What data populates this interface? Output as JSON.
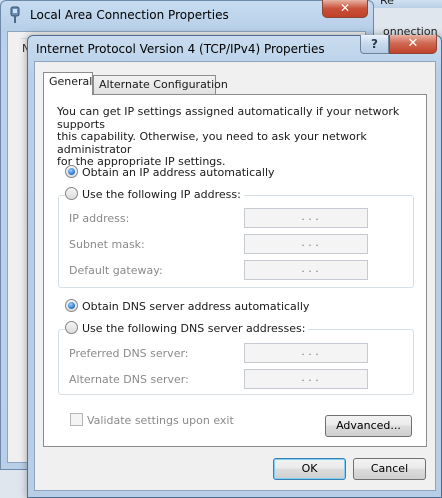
{
  "background": {
    "window_title": "Local Area Connection Properties",
    "partial_text_top": "Re",
    "partial_text_right": "onnection",
    "partial_letter": "N",
    "close_glyph": "✕"
  },
  "dialog": {
    "title": "Internet Protocol Version 4 (TCP/IPv4) Properties",
    "help_glyph": "?",
    "close_glyph": "✕",
    "tabs": [
      {
        "label": "General",
        "active": true
      },
      {
        "label": "Alternate Configuration",
        "active": false
      }
    ],
    "intro": "You can get IP settings assigned automatically if your network supports\nthis capability. Otherwise, you need to ask your network administrator\nfor the appropriate IP settings.",
    "ip_auto_label": "Obtain an IP address automatically",
    "ip_manual_label": "Use the following IP address:",
    "ip_fields": [
      {
        "label": "IP address:",
        "value": ".      .      ."
      },
      {
        "label": "Subnet mask:",
        "value": ".      .      ."
      },
      {
        "label": "Default gateway:",
        "value": ".      .      ."
      }
    ],
    "dns_auto_label": "Obtain DNS server address automatically",
    "dns_manual_label": "Use the following DNS server addresses:",
    "dns_fields": [
      {
        "label": "Preferred DNS server:",
        "value": ".      .      ."
      },
      {
        "label": "Alternate DNS server:",
        "value": ".      .      ."
      }
    ],
    "validate_label": "Validate settings upon exit",
    "advanced_label": "Advanced...",
    "ok_label": "OK",
    "cancel_label": "Cancel"
  }
}
